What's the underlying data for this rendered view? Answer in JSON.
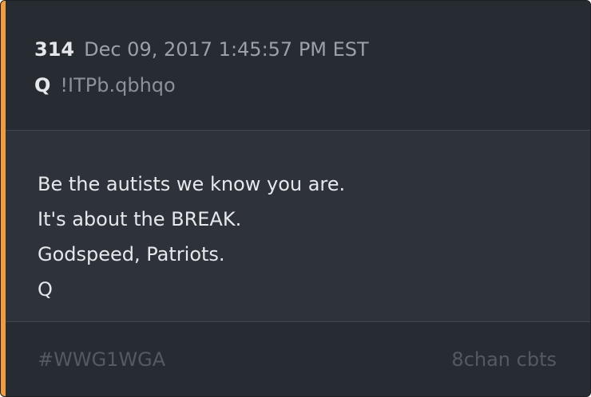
{
  "post": {
    "number": "314",
    "date": "Dec 09, 2017 1:45:57 PM EST",
    "author": "Q",
    "tripcode": "!ITPb.qbhqo",
    "lines": [
      "Be the autists we know you are.",
      "It's about the BREAK.",
      "Godspeed, Patriots.",
      "Q"
    ]
  },
  "footer": {
    "hashtag": "#WWG1WGA",
    "source": "8chan cbts"
  },
  "colors": {
    "accent": "#f19a3e",
    "header_bg": "#272b32",
    "body_bg": "#2e333b",
    "text": "#e6e8eb",
    "muted": "#9aa1ab"
  }
}
